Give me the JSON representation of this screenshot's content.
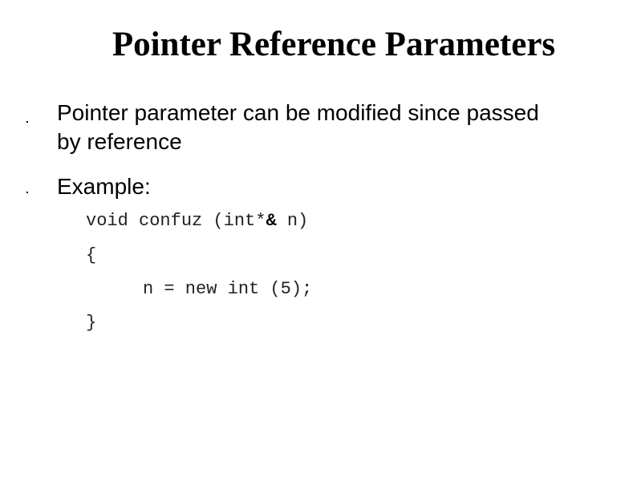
{
  "slide": {
    "title": "Pointer Reference Parameters",
    "bullets": [
      {
        "line1": "Pointer parameter can be modified since passed",
        "line2": "by reference"
      },
      {
        "line1": "Example:"
      }
    ],
    "code": {
      "signature_prefix": "void confuz (int*",
      "ampersand": "&",
      "signature_suffix": " n)",
      "open_brace": "{",
      "body": "n = new int (5);",
      "close_brace": "}"
    }
  }
}
